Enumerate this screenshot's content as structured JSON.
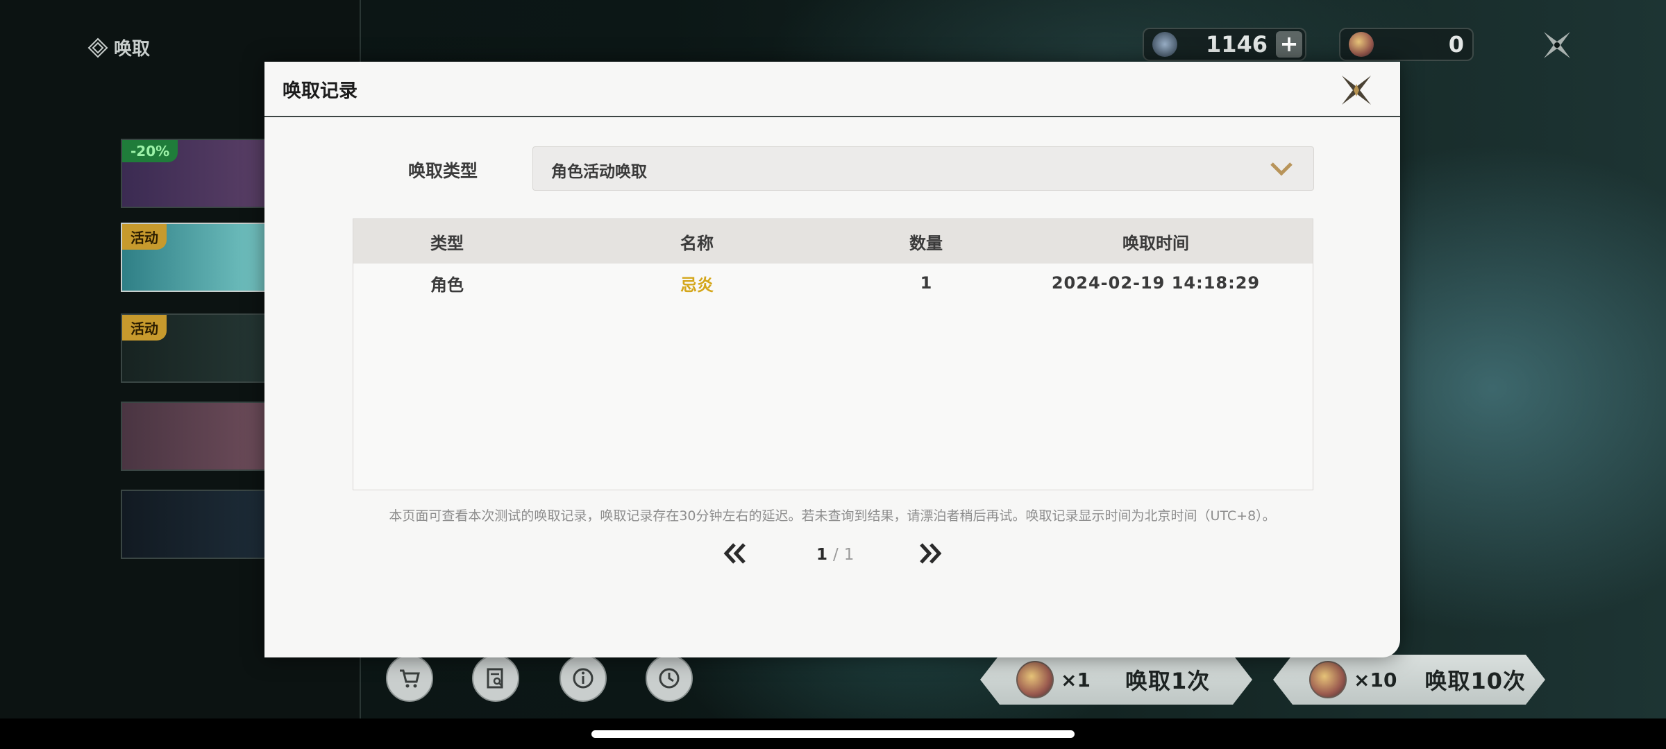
{
  "header": {
    "section_title": "唤取",
    "currency_star": "1146",
    "currency_coin": "0"
  },
  "banners": [
    {
      "tag": "-20%"
    },
    {
      "tag": "活动"
    },
    {
      "tag": "活动"
    },
    {
      "tag": ""
    },
    {
      "tag": ""
    }
  ],
  "bottom": {
    "pull1_mult": "×1",
    "pull1_label": "唤取1次",
    "pull10_mult": "×10",
    "pull10_label": "唤取10次"
  },
  "modal": {
    "title": "唤取记录",
    "filter_label": "唤取类型",
    "filter_value": "角色活动唤取",
    "columns": [
      "类型",
      "名称",
      "数量",
      "唤取时间"
    ],
    "rows": [
      {
        "type": "角色",
        "name": "忌炎",
        "count": "1",
        "time": "2024-02-19 14:18:29"
      }
    ],
    "note": "本页面可查看本次测试的唤取记录，唤取记录存在30分钟左右的延迟。若未查询到结果，请漂泊者稍后再试。唤取记录显示时间为北京时间（UTC+8）。",
    "page_current": "1",
    "page_sep": "/",
    "page_total": "1"
  },
  "colors": {
    "accent_gold": "#d4a61a",
    "modal_bg": "#f7f7f6",
    "header_bg": "#e5e3e0"
  },
  "icons": [
    "convene-icon",
    "star-currency-icon",
    "plus-icon",
    "coin-icon",
    "close-icon",
    "chevron-down-icon",
    "shop-icon",
    "record-icon",
    "info-icon",
    "history-icon",
    "double-chevron-left-icon",
    "double-chevron-right-icon"
  ]
}
